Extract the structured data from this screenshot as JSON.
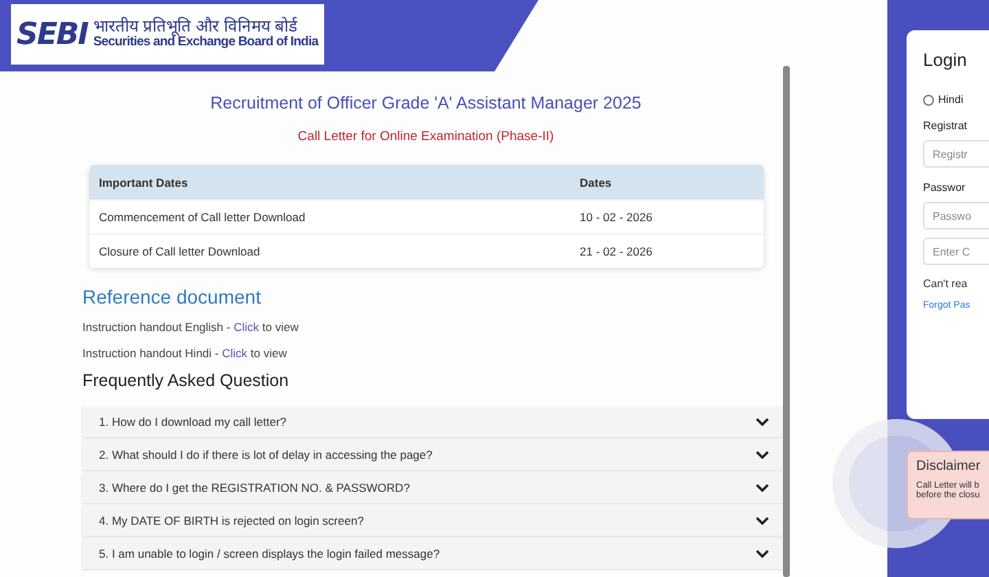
{
  "header": {
    "logo_mark": "SEBI",
    "hindi_name": "भारतीय प्रतिभूति और विनिमय बोर्ड",
    "english_name": "Securities and Exchange Board of India"
  },
  "title": "Recruitment of Officer Grade 'A' Assistant Manager 2025",
  "subtitle": "Call Letter for Online Examination (Phase-II)",
  "dates_table": {
    "columns": [
      "Important Dates",
      "Dates"
    ],
    "rows": [
      {
        "event": "Commencement of Call letter Download",
        "date": "10 - 02 - 2026"
      },
      {
        "event": "Closure of Call letter Download",
        "date": "21 - 02 - 2026"
      }
    ]
  },
  "reference": {
    "heading": "Reference document",
    "items": [
      {
        "before": "Instruction handout English - ",
        "link": "Click",
        "after": " to view"
      },
      {
        "before": "Instruction handout Hindi - ",
        "link": "Click",
        "after": " to view"
      }
    ]
  },
  "faq": {
    "heading": "Frequently Asked Question",
    "items": [
      {
        "question": "1. How do I download my call letter?",
        "expanded": false
      },
      {
        "question": "2. What should I do if there is lot of delay in accessing the page?",
        "expanded": false
      },
      {
        "question": "3. Where do I get the REGISTRATION NO. & PASSWORD?",
        "expanded": false
      },
      {
        "question": "4. My DATE OF BIRTH is rejected on login screen?",
        "expanded": false
      },
      {
        "question": "5. I am unable to login / screen displays the login failed message?",
        "expanded": false
      }
    ]
  },
  "login": {
    "title": "Login",
    "language_option": {
      "label": "Hindi",
      "selected": false
    },
    "fields": [
      {
        "label": "Registrat",
        "placeholder": "Registr"
      },
      {
        "label": "Passwor",
        "placeholder": "Passwo"
      },
      {
        "placeholder": "Enter C"
      }
    ],
    "captcha_note": "Can't rea",
    "forgot_link": "Forgot Pas"
  },
  "disclaimer": {
    "title": "Disclaimer",
    "lines": [
      "Call Letter will b",
      "before the closu"
    ]
  }
}
